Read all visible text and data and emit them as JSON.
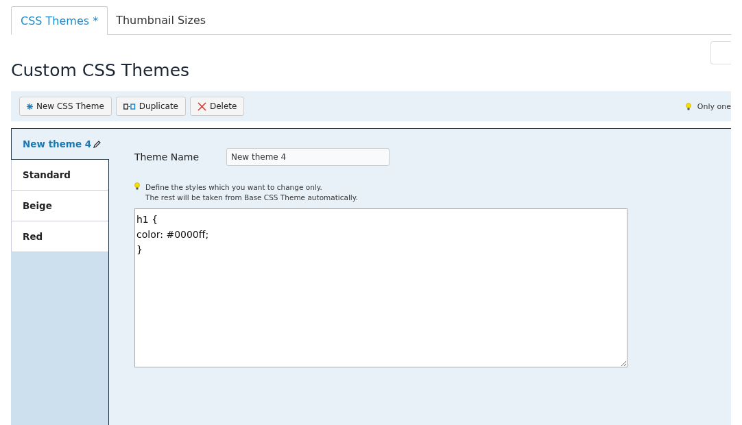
{
  "tabs": [
    {
      "label": "CSS Themes *",
      "selected": true
    },
    {
      "label": "Thumbnail Sizes",
      "selected": false
    }
  ],
  "heading": "Custom CSS Themes",
  "toolbar": {
    "buttons": [
      {
        "kind": "new",
        "label": "New CSS Theme"
      },
      {
        "kind": "duplicate",
        "label": "Duplicate"
      },
      {
        "kind": "delete",
        "label": "Delete"
      }
    ],
    "hint": "Only one"
  },
  "themes": [
    {
      "label": "New theme 4",
      "selected": true
    },
    {
      "label": "Standard",
      "selected": false
    },
    {
      "label": "Beige",
      "selected": false
    },
    {
      "label": "Red",
      "selected": false
    }
  ],
  "editor": {
    "name_label": "Theme Name",
    "name_value": "New theme 4",
    "hint_lines": [
      "Define the styles which you want to change only.",
      "The rest will be taken from Base CSS Theme automatically."
    ],
    "css": "h1 {\ncolor: #0000ff;\n}"
  }
}
